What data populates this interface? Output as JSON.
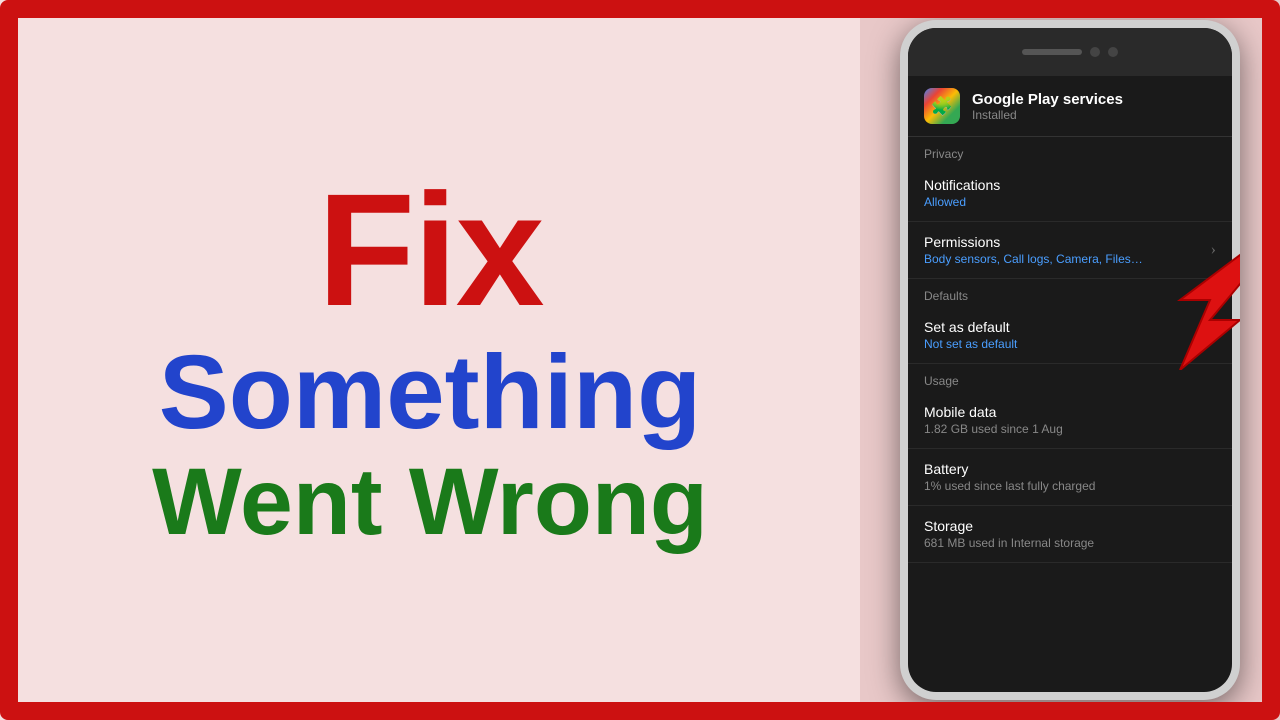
{
  "border": {
    "color": "#cc1111"
  },
  "left": {
    "fix_label": "Fix",
    "something_label": "Something",
    "went_wrong_label": "Went Wrong"
  },
  "phone": {
    "app": {
      "name": "Google Play services",
      "status": "Installed",
      "icon_emoji": "🧩"
    },
    "sections": [
      {
        "header": "Privacy",
        "items": [
          {
            "title": "Notifications",
            "subtitle": "Allowed",
            "subtitle_color": "blue",
            "has_chevron": false
          },
          {
            "title": "Permissions",
            "subtitle": "Body sensors, Call logs, Camera, Files and media, Microphone, Phone, Activity and SMS",
            "subtitle_color": "blue",
            "has_chevron": true
          }
        ]
      },
      {
        "header": "Defaults",
        "items": [
          {
            "title": "Set as default",
            "subtitle": "Not set as default",
            "subtitle_color": "blue",
            "has_chevron": false
          }
        ]
      },
      {
        "header": "Usage",
        "items": [
          {
            "title": "Mobile data",
            "subtitle": "1.82 GB used since 1 Aug",
            "subtitle_color": "gray",
            "has_chevron": false
          },
          {
            "title": "Battery",
            "subtitle": "1% used since last fully charged",
            "subtitle_color": "gray",
            "has_chevron": false
          },
          {
            "title": "Storage",
            "subtitle": "681 MB used in Internal storage",
            "subtitle_color": "gray",
            "has_chevron": false
          }
        ]
      }
    ]
  }
}
